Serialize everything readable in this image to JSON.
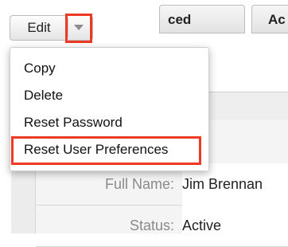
{
  "toolbar": {
    "edit_label": "Edit",
    "dropdown_icon": "chevron-down-icon"
  },
  "menu": {
    "items": [
      {
        "label": "Copy"
      },
      {
        "label": "Delete"
      },
      {
        "label": "Reset Password"
      },
      {
        "label": "Reset User Preferences"
      }
    ]
  },
  "tabs": [
    {
      "label": "ced"
    },
    {
      "label": "Ac"
    }
  ],
  "details": {
    "full_name_label": "Full Name:",
    "full_name_value": "Jim Brennan",
    "status_label": "Status:",
    "status_value": "Active"
  },
  "colors": {
    "highlight": "#ee3a24"
  }
}
